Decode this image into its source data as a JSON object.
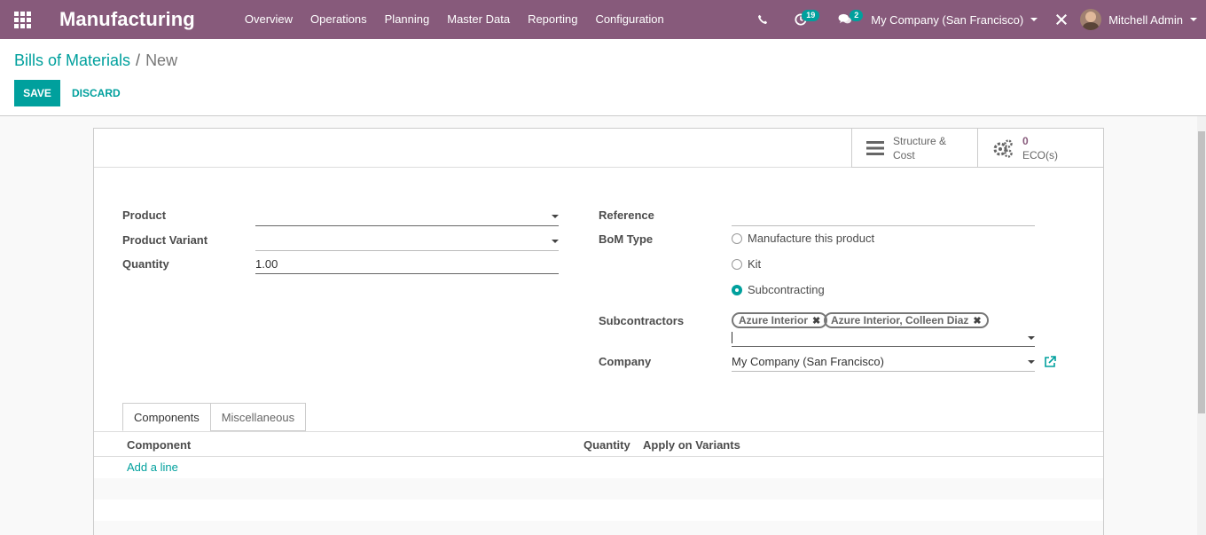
{
  "navbar": {
    "app_name": "Manufacturing",
    "menu": [
      "Overview",
      "Operations",
      "Planning",
      "Master Data",
      "Reporting",
      "Configuration"
    ],
    "activity_count": "19",
    "message_count": "2",
    "company": "My Company (San Francisco)",
    "user": "Mitchell Admin",
    "color": "#875a7b"
  },
  "breadcrumb": {
    "parent": "Bills of Materials",
    "separator": "/",
    "current": "New"
  },
  "actions": {
    "save_label": "SAVE",
    "discard_label": "DISCARD"
  },
  "smart_buttons": {
    "structure": {
      "line1": "Structure &",
      "line2": "Cost"
    },
    "eco": {
      "value": "0",
      "label": "ECO(s)"
    }
  },
  "form": {
    "product_label": "Product",
    "product_value": "",
    "variant_label": "Product Variant",
    "variant_value": "",
    "quantity_label": "Quantity",
    "quantity_value": "1.00",
    "reference_label": "Reference",
    "reference_value": "",
    "bom_type_label": "BoM Type",
    "bom_types": [
      {
        "label": "Manufacture this product",
        "checked": false
      },
      {
        "label": "Kit",
        "checked": false
      },
      {
        "label": "Subcontracting",
        "checked": true
      }
    ],
    "subcontractors_label": "Subcontractors",
    "subcontractors": [
      "Azure Interior",
      "Azure Interior, Colleen Diaz"
    ],
    "company_label": "Company",
    "company_value": "My Company (San Francisco)"
  },
  "tabs": [
    "Components",
    "Miscellaneous"
  ],
  "table": {
    "columns": [
      "Component",
      "Quantity",
      "Apply on Variants"
    ],
    "add_line": "Add a line"
  },
  "accent_color": "#00a09d"
}
